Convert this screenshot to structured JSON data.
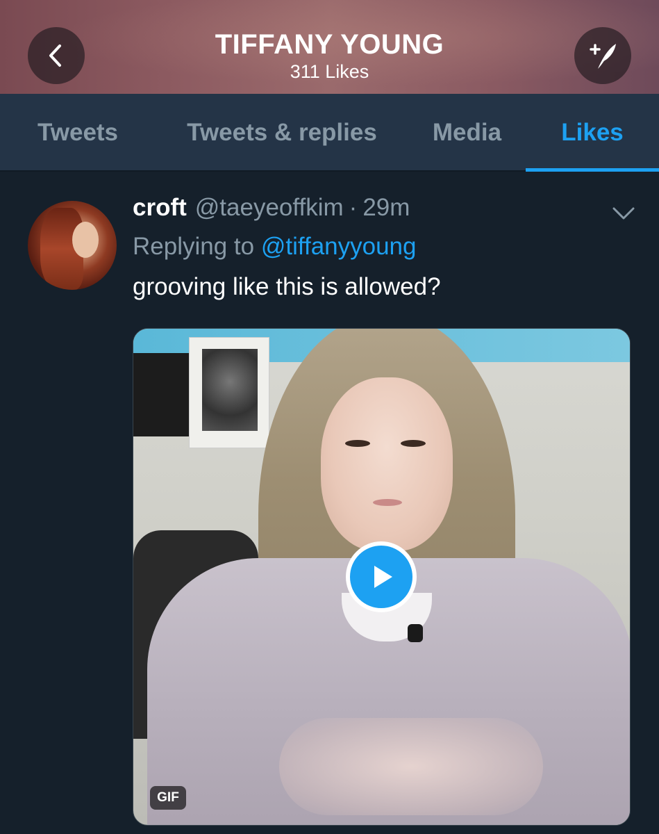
{
  "header": {
    "title": "TIFFANY YOUNG",
    "subtitle": "311 Likes",
    "back_icon": "chevron-left-icon",
    "compose_icon": "feather-plus-icon",
    "colors": {
      "bg": "#8c5a60",
      "button_bg": "#281e24"
    }
  },
  "tabs": [
    {
      "label": "Tweets",
      "active": false
    },
    {
      "label": "Tweets & replies",
      "active": false
    },
    {
      "label": "Media",
      "active": false
    },
    {
      "label": "Likes",
      "active": true
    }
  ],
  "tweet": {
    "name": "croft",
    "handle": "@taeyeoffkim",
    "separator": "·",
    "time": "29m",
    "replying_prefix": "Replying to",
    "replying_to": "@tiffanyyoung",
    "text": "grooving like this is allowed?",
    "media": {
      "badge": "GIF",
      "play_icon": "play-icon"
    },
    "caret_icon": "chevron-down-icon"
  },
  "colors": {
    "background": "#15202b",
    "tabs_bg": "#243447",
    "accent": "#1da1f2",
    "secondary_text": "#8899a6"
  }
}
